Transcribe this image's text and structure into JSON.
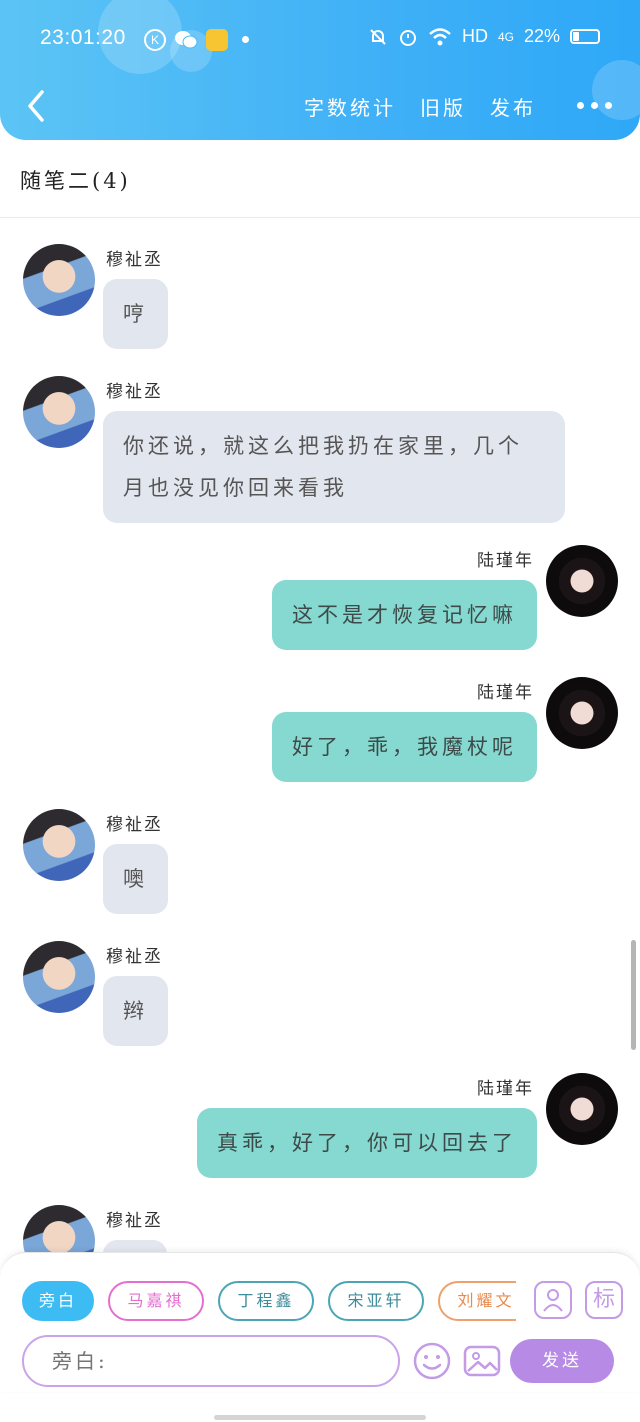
{
  "status_bar": {
    "time": "23:01:20",
    "network": "HD",
    "signal": "4G",
    "battery": "22%"
  },
  "nav": {
    "actions": [
      "字数统计",
      "旧版",
      "发布"
    ]
  },
  "title": "随笔二(4)",
  "messages": [
    {
      "side": "left",
      "sender": "穆祉丞",
      "text": "哼"
    },
    {
      "side": "left",
      "sender": "穆祉丞",
      "text": "你还说，就这么把我扔在家里，几个月也没见你回来看我"
    },
    {
      "side": "right",
      "sender": "陆瑾年",
      "text": "这不是才恢复记忆嘛"
    },
    {
      "side": "right",
      "sender": "陆瑾年",
      "text": "好了，乖，我魔杖呢"
    },
    {
      "side": "left",
      "sender": "穆祉丞",
      "text": "噢"
    },
    {
      "side": "left",
      "sender": "穆祉丞",
      "text": "辫"
    },
    {
      "side": "right",
      "sender": "陆瑾年",
      "text": "真乖，好了，你可以回去了"
    },
    {
      "side": "left",
      "sender": "穆祉丞",
      "text": ""
    }
  ],
  "roles": [
    {
      "label": "旁白",
      "color": "#3dbcf4",
      "active": true
    },
    {
      "label": "马嘉祺",
      "color": "#e36fd0",
      "active": false
    },
    {
      "label": "丁程鑫",
      "color": "#4aa5b5",
      "active": false
    },
    {
      "label": "宋亚轩",
      "color": "#4aa5b5",
      "active": false
    },
    {
      "label": "刘耀文",
      "color": "#f0a06a",
      "active": false
    }
  ],
  "tools": {
    "tag_label": "标"
  },
  "composer": {
    "placeholder": "旁白:",
    "send_label": "发送"
  }
}
